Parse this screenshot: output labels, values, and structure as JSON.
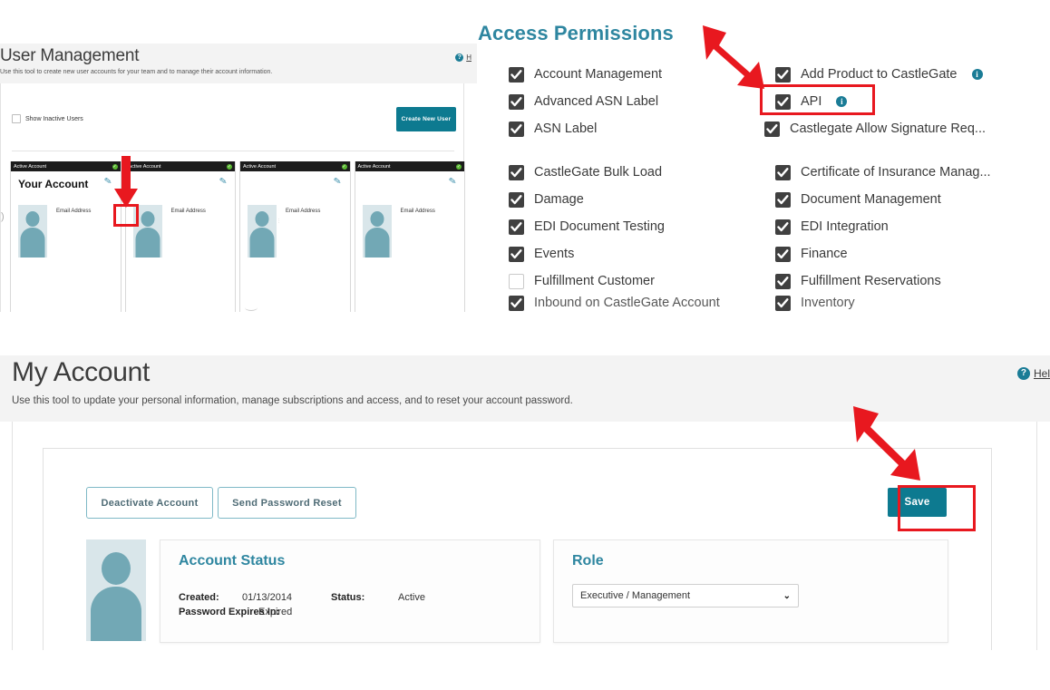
{
  "user_management": {
    "title": "User Management",
    "subtitle": "Use this tool to create new user accounts for your team and to manage their account information.",
    "help_label": "H",
    "help_icon": "question-circle-icon",
    "show_inactive_label": "Show Inactive Users",
    "create_button": "Create New User",
    "cards": [
      {
        "status": "Active Account",
        "name": "Your Account",
        "email_label": "Email Address",
        "pencil_icon": "pencil-edit-icon",
        "status_icon": "green-check-circle-icon"
      },
      {
        "status": "Active Account",
        "name": "",
        "email_label": "Email Address",
        "pencil_icon": "pencil-edit-icon",
        "status_icon": "green-check-circle-icon"
      },
      {
        "status": "Active Account",
        "name": "",
        "email_label": "Email Address",
        "pencil_icon": "pencil-edit-icon",
        "status_icon": "green-check-circle-icon"
      },
      {
        "status": "Active Account",
        "name": "",
        "email_label": "Email Address",
        "pencil_icon": "pencil-edit-icon",
        "status_icon": "green-check-circle-icon"
      }
    ]
  },
  "access_permissions": {
    "title": "Access Permissions",
    "title_color": "#2e86a0",
    "checkbox_color": "#404040",
    "info_icon_color": "#1a7c96",
    "left_column": [
      {
        "label": "Account Management",
        "checked": true,
        "info": false
      },
      {
        "label": "Advanced ASN Label",
        "checked": true,
        "info": false
      },
      {
        "label": "ASN Label",
        "checked": true,
        "info": false
      },
      {
        "label": "CastleGate Bulk Load",
        "checked": true,
        "info": false
      },
      {
        "label": "Damage",
        "checked": true,
        "info": false
      },
      {
        "label": "EDI Document Testing",
        "checked": true,
        "info": false
      },
      {
        "label": "Events",
        "checked": true,
        "info": false
      },
      {
        "label": "Fulfillment Customer",
        "checked": false,
        "info": false
      },
      {
        "label": "Inbound on CastleGate Account",
        "checked": true,
        "info": false
      }
    ],
    "right_column": [
      {
        "label": "Add Product to CastleGate",
        "checked": true,
        "info": true
      },
      {
        "label": "API",
        "checked": true,
        "info": true
      },
      {
        "label": "Castlegate Allow Signature Req...",
        "checked": true,
        "info": false
      },
      {
        "label": "Certificate of Insurance Manag...",
        "checked": true,
        "info": false
      },
      {
        "label": "Document Management",
        "checked": true,
        "info": false
      },
      {
        "label": "EDI Integration",
        "checked": true,
        "info": false
      },
      {
        "label": "Finance",
        "checked": true,
        "info": false
      },
      {
        "label": "Fulfillment Reservations",
        "checked": true,
        "info": false
      },
      {
        "label": "Inventory",
        "checked": true,
        "info": false
      }
    ]
  },
  "my_account": {
    "title": "My Account",
    "subtitle": "Use this tool to update your personal information, manage subscriptions and access, and to reset your account password.",
    "help_label": "Hel",
    "help_icon": "question-circle-icon",
    "deactivate_button": "Deactivate Account",
    "reset_button": "Send Password Reset",
    "save_button": "Save",
    "avatar_icon": "user-avatar-icon",
    "account_status": {
      "title": "Account Status",
      "created_label": "Created:",
      "created_value": "01/13/2014",
      "status_label": "Status:",
      "status_value": "Active",
      "password_label": "Password Expires In:",
      "password_value": "Expired"
    },
    "role": {
      "title": "Role",
      "selected": "Executive / Management",
      "caret_icon": "chevron-down-icon"
    }
  },
  "annotations": {
    "arrow_color": "#e8181f",
    "highlight_color": "#e8181f",
    "items": [
      {
        "name": "arrow-to-edit-pencil",
        "direction": "down"
      },
      {
        "name": "arrow-to-api-permission",
        "direction": "down-right"
      },
      {
        "name": "arrow-to-save-button",
        "direction": "down-right"
      }
    ]
  }
}
